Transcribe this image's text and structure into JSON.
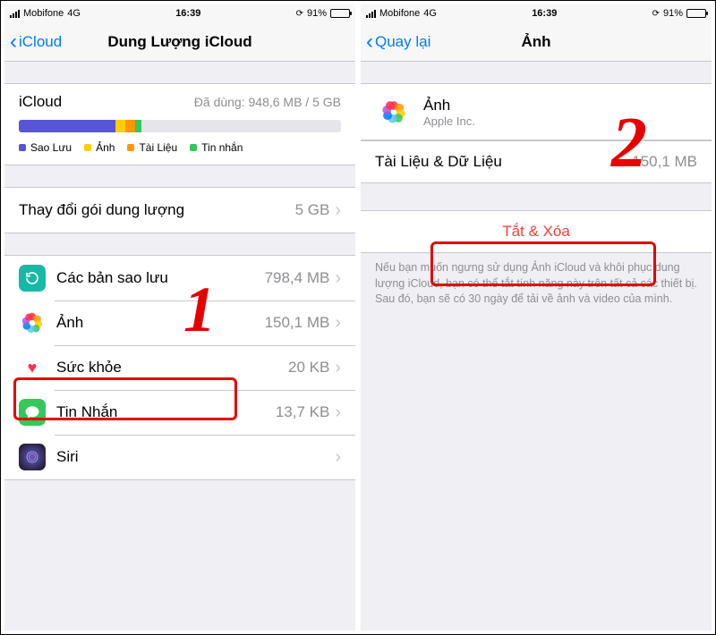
{
  "statusbar": {
    "carrier": "Mobifone",
    "network": "4G",
    "time": "16:39",
    "battery_pct": "91%"
  },
  "left": {
    "back_label": "iCloud",
    "title": "Dung Lượng iCloud",
    "storage": {
      "title": "iCloud",
      "used_text": "Đã dùng: 948,6 MB / 5 GB",
      "legend": [
        "Sao Lưu",
        "Ảnh",
        "Tài Liệu",
        "Tin nhắn"
      ]
    },
    "plan_row": {
      "label": "Thay đổi gói dung lượng",
      "value": "5 GB"
    },
    "items": [
      {
        "label": "Các bản sao lưu",
        "value": "798,4 MB"
      },
      {
        "label": "Ảnh",
        "value": "150,1 MB"
      },
      {
        "label": "Sức khỏe",
        "value": "20 KB"
      },
      {
        "label": "Tin Nhắn",
        "value": "13,7 KB"
      },
      {
        "label": "Siri",
        "value": ""
      }
    ],
    "annotation_number": "1"
  },
  "right": {
    "back_label": "Quay lại",
    "title": "Ảnh",
    "app": {
      "name": "Ảnh",
      "vendor": "Apple Inc."
    },
    "data_row": {
      "label": "Tài Liệu & Dữ Liệu",
      "value": "150,1 MB"
    },
    "delete_label": "Tắt & Xóa",
    "footer": "Nếu bạn muốn ngưng sử dụng Ảnh iCloud và khôi phục dung lượng iCloud, bạn có thể tắt tính năng này trên tất cả các thiết bị. Sau đó, bạn sẽ có 30 ngày để tải về ảnh và video của mình.",
    "annotation_number": "2"
  }
}
